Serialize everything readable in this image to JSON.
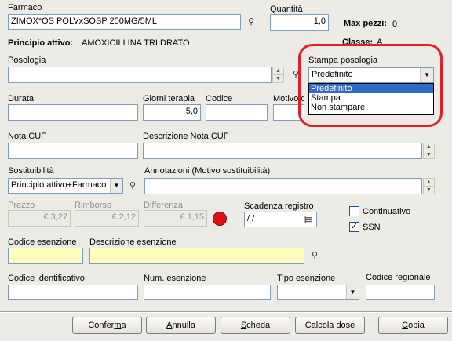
{
  "farmaco": {
    "label": "Farmaco",
    "value": "ZIMOX*OS POLVxSOSP 250MG/5ML"
  },
  "quantita": {
    "label": "Quantità",
    "value": "1,0"
  },
  "max_pezzi": {
    "label": "Max pezzi:",
    "value": "0"
  },
  "classe": {
    "label": "Classe:",
    "value": "A"
  },
  "principio": {
    "label": "Principio attivo:",
    "value": "AMOXICILLINA TRIIDRATO"
  },
  "posologia": {
    "label": "Posologia",
    "value": ""
  },
  "stampa_posologia": {
    "label": "Stampa posologia",
    "selected": "Predefinito",
    "options": [
      "Predefinito",
      "Stampa",
      "Non stampare"
    ]
  },
  "durata": {
    "label": "Durata",
    "value": ""
  },
  "giorni_terapia": {
    "label": "Giorni terapia",
    "value": "5,0"
  },
  "codice": {
    "label": "Codice",
    "value": ""
  },
  "motivo": {
    "label": "Motivo de"
  },
  "nota_cuf": {
    "label": "Nota CUF",
    "value": ""
  },
  "descrizione_nota": {
    "label": "Descrizione Nota CUF",
    "value": ""
  },
  "sostituibilita": {
    "label": "Sostituibilità",
    "selected": "Principio attivo+Farmaco"
  },
  "annotazioni": {
    "label": "Annotazioni (Motivo sostituibilità)",
    "value": ""
  },
  "prezzo": {
    "label": "Prezzo",
    "value": "€ 3,27"
  },
  "rimborso": {
    "label": "Rimborso",
    "value": "€ 2,12"
  },
  "differenza": {
    "label": "Differenza",
    "value": "€ 1,15"
  },
  "scadenza": {
    "label": "Scadenza registro",
    "value": "/ /"
  },
  "continuativo": {
    "label": "Continuativo",
    "checked": false
  },
  "ssn": {
    "label": "SSN",
    "checked": true
  },
  "codice_esenzione": {
    "label": "Codice esenzione",
    "value": ""
  },
  "descrizione_esenzione": {
    "label": "Descrizione esenzione",
    "value": ""
  },
  "codice_identificativo": {
    "label": "Codice identificativo",
    "value": ""
  },
  "num_esenzione": {
    "label": "Num. esenzione",
    "value": ""
  },
  "tipo_esenzione": {
    "label": "Tipo esenzione",
    "selected": ""
  },
  "codice_regionale": {
    "label": "Codice regionale",
    "value": ""
  },
  "buttons": {
    "conferma": {
      "pre": "Confer",
      "u": "m",
      "post": "a"
    },
    "annulla": {
      "pre": "",
      "u": "A",
      "post": "nnulla"
    },
    "scheda": {
      "pre": "",
      "u": "S",
      "post": "cheda"
    },
    "calcola": {
      "pre": "Calcola dose",
      "u": "",
      "post": ""
    },
    "copia": {
      "pre": "",
      "u": "C",
      "post": "opia"
    }
  },
  "colors": {
    "highlight": "#e0202a",
    "status_dot": "#dd1111",
    "selection": "#316ac5",
    "yellow_field": "#ffffc0"
  }
}
